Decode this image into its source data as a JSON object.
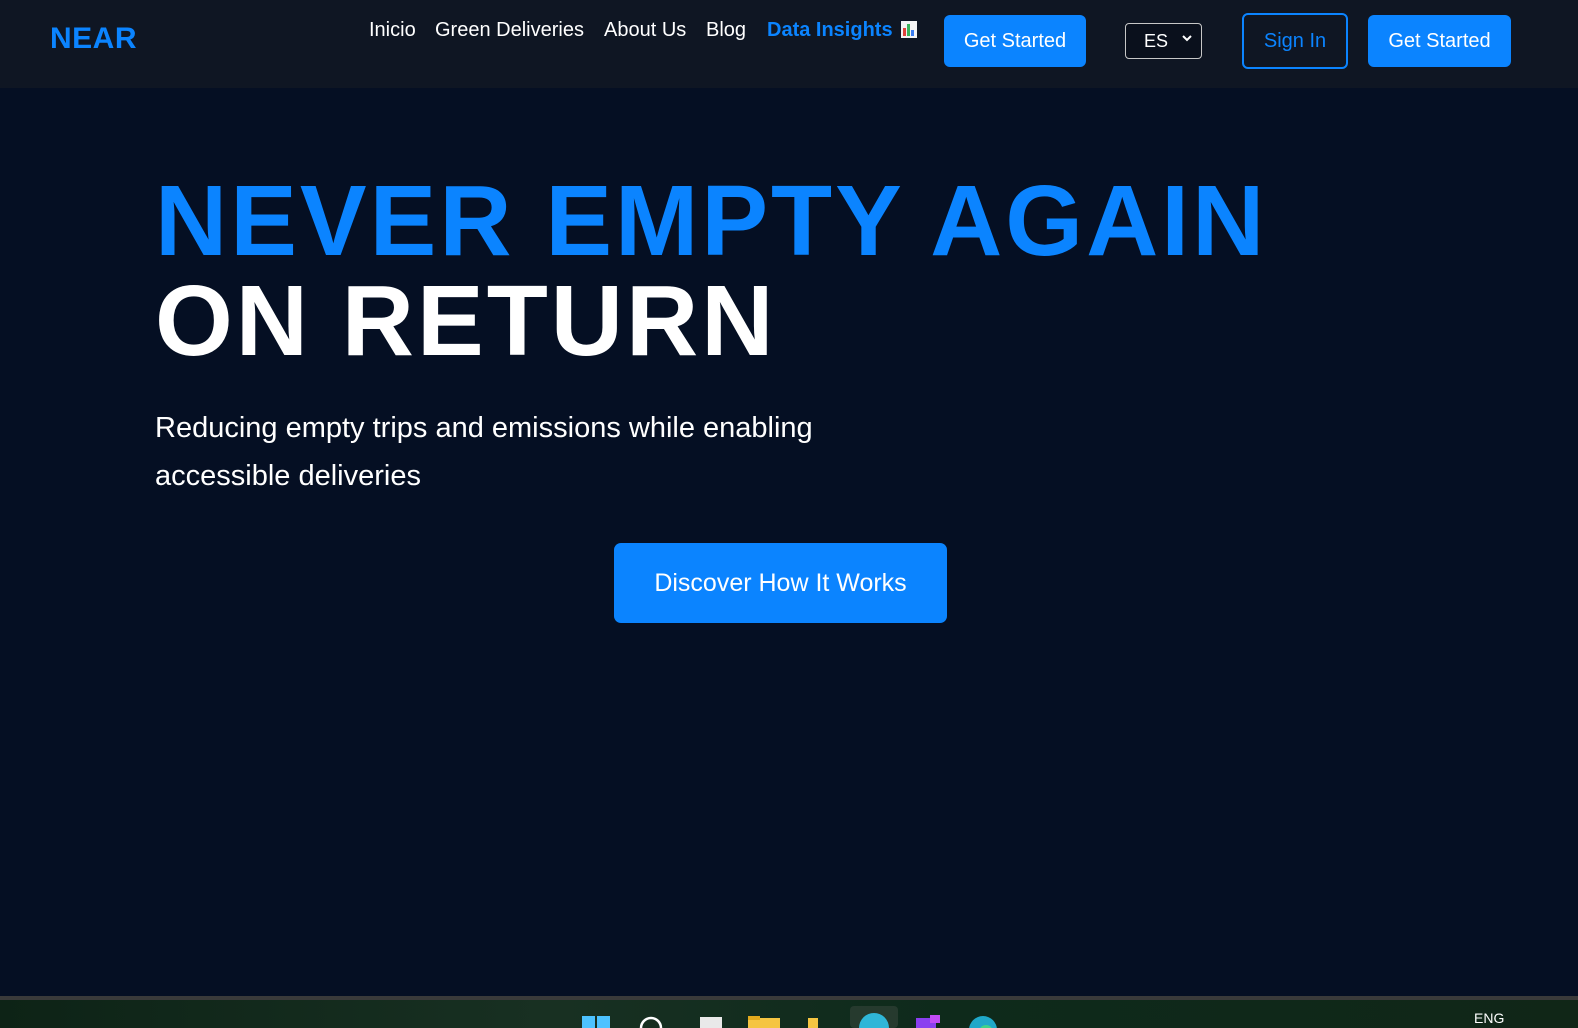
{
  "header": {
    "logo": "NEAR",
    "nav": [
      {
        "label": "Inicio"
      },
      {
        "label": "Green Deliveries"
      },
      {
        "label": "About Us"
      },
      {
        "label": "Blog"
      },
      {
        "label": "Data Insights",
        "active": true
      }
    ],
    "get_started_label": "Get Started",
    "language": {
      "selected": "ES"
    },
    "sign_in_label": "Sign In",
    "get_started_right_label": "Get Started"
  },
  "hero": {
    "title_line1": "NEVER EMPTY AGAIN",
    "title_line2": "ON RETURN",
    "subtitle": "Reducing empty trips and emissions while enabling accessible deliveries",
    "cta_label": "Discover How It Works"
  },
  "taskbar": {
    "tray_language": "ENG"
  },
  "colors": {
    "accent": "#0b84ff",
    "background": "#050f23",
    "header_background": "#0f1623",
    "text": "#ffffff"
  },
  "icons": [
    "chart-emoji-icon",
    "chevron-down-icon",
    "windows-start-icon",
    "search-icon",
    "file-icon",
    "folder-icon",
    "edge-icon"
  ]
}
